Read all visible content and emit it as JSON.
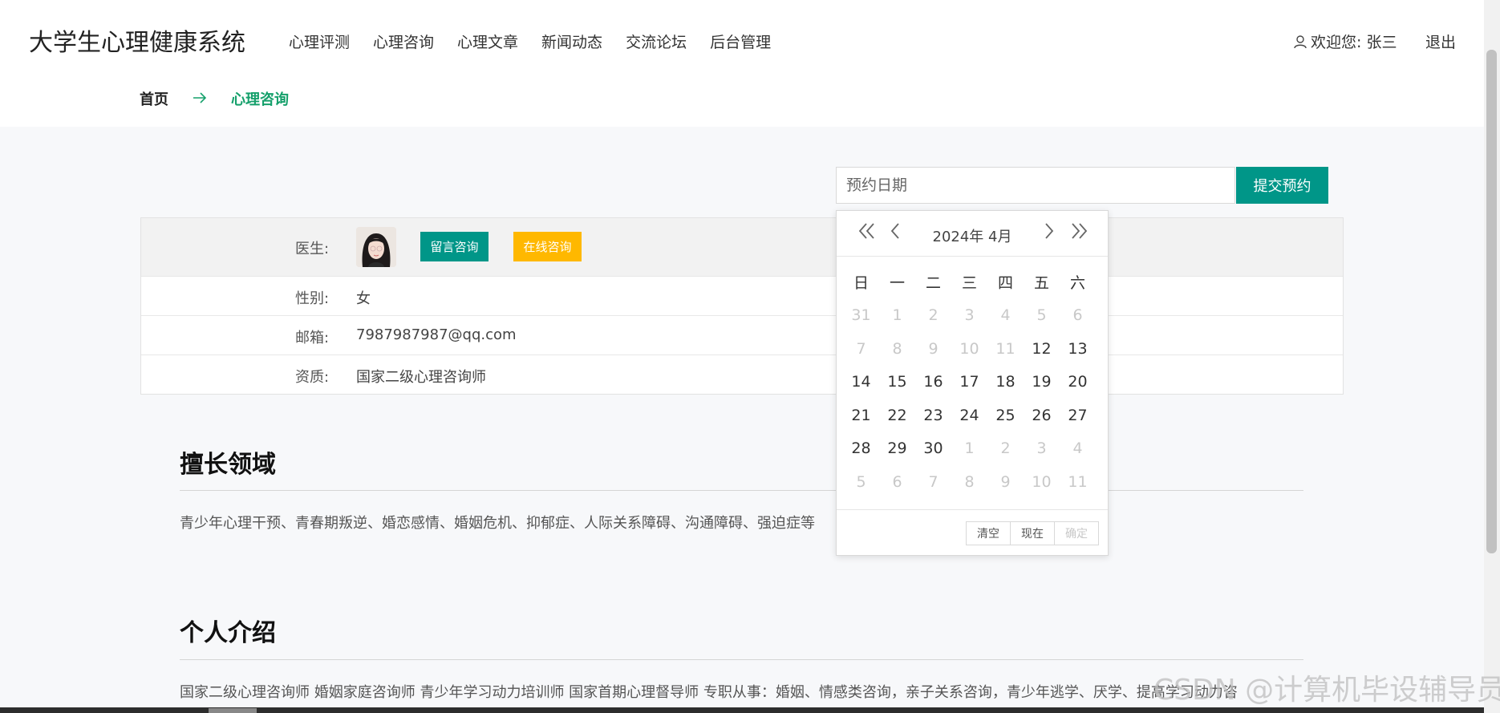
{
  "header": {
    "brand": "大学生心理健康系统",
    "nav": [
      "心理评测",
      "心理咨询",
      "心理文章",
      "新闻动态",
      "交流论坛",
      "后台管理"
    ],
    "user_text": "欢迎您: 张三",
    "logout": "退出"
  },
  "breadcrumb": {
    "home": "首页",
    "current": "心理咨询"
  },
  "appointment": {
    "date_placeholder": "预约日期",
    "submit_label": "提交预约"
  },
  "doctor": {
    "label_doctor": "医生:",
    "btn_message": "留言咨询",
    "btn_online": "在线咨询",
    "label_gender": "性别:",
    "gender": "女",
    "label_email": "邮箱:",
    "email": "7987987987@qq.com",
    "label_qualification": "资质:",
    "qualification": "国家二级心理咨询师"
  },
  "specialty": {
    "title": "擅长领域",
    "text": "青少年心理干预、青春期叛逆、婚恋感情、婚姻危机、抑郁症、人际关系障碍、沟通障碍、强迫症等"
  },
  "intro": {
    "title": "个人介绍",
    "text": "国家二级心理咨询师 婚姻家庭咨询师 青少年学习动力培训师 国家首期心理督导师 专职从事：婚姻、情感类咨询，亲子关系咨询，青少年逃学、厌学、提高学习动力咨"
  },
  "calendar": {
    "year_month": "2024年  4月",
    "weekdays": [
      "日",
      "一",
      "二",
      "三",
      "四",
      "五",
      "六"
    ],
    "weeks": [
      [
        {
          "d": "31",
          "dim": true
        },
        {
          "d": "1",
          "dim": true
        },
        {
          "d": "2",
          "dim": true
        },
        {
          "d": "3",
          "dim": true
        },
        {
          "d": "4",
          "dim": true
        },
        {
          "d": "5",
          "dim": true
        },
        {
          "d": "6",
          "dim": true
        }
      ],
      [
        {
          "d": "7",
          "dim": true
        },
        {
          "d": "8",
          "dim": true
        },
        {
          "d": "9",
          "dim": true
        },
        {
          "d": "10",
          "dim": true
        },
        {
          "d": "11",
          "dim": true
        },
        {
          "d": "12",
          "dim": false
        },
        {
          "d": "13",
          "dim": false
        }
      ],
      [
        {
          "d": "14",
          "dim": false
        },
        {
          "d": "15",
          "dim": false
        },
        {
          "d": "16",
          "dim": false
        },
        {
          "d": "17",
          "dim": false
        },
        {
          "d": "18",
          "dim": false
        },
        {
          "d": "19",
          "dim": false
        },
        {
          "d": "20",
          "dim": false
        }
      ],
      [
        {
          "d": "21",
          "dim": false
        },
        {
          "d": "22",
          "dim": false
        },
        {
          "d": "23",
          "dim": false
        },
        {
          "d": "24",
          "dim": false
        },
        {
          "d": "25",
          "dim": false
        },
        {
          "d": "26",
          "dim": false
        },
        {
          "d": "27",
          "dim": false
        }
      ],
      [
        {
          "d": "28",
          "dim": false
        },
        {
          "d": "29",
          "dim": false
        },
        {
          "d": "30",
          "dim": false
        },
        {
          "d": "1",
          "dim": true
        },
        {
          "d": "2",
          "dim": true
        },
        {
          "d": "3",
          "dim": true
        },
        {
          "d": "4",
          "dim": true
        }
      ],
      [
        {
          "d": "5",
          "dim": true
        },
        {
          "d": "6",
          "dim": true
        },
        {
          "d": "7",
          "dim": true
        },
        {
          "d": "8",
          "dim": true
        },
        {
          "d": "9",
          "dim": true
        },
        {
          "d": "10",
          "dim": true
        },
        {
          "d": "11",
          "dim": true
        }
      ]
    ],
    "btn_clear": "清空",
    "btn_now": "现在",
    "btn_confirm": "确定"
  },
  "watermark": "CSDN @计算机毕设辅导员",
  "colors": {
    "primary": "#009688",
    "warning": "#ffb800",
    "breadcrumb_active": "#15a06b"
  }
}
